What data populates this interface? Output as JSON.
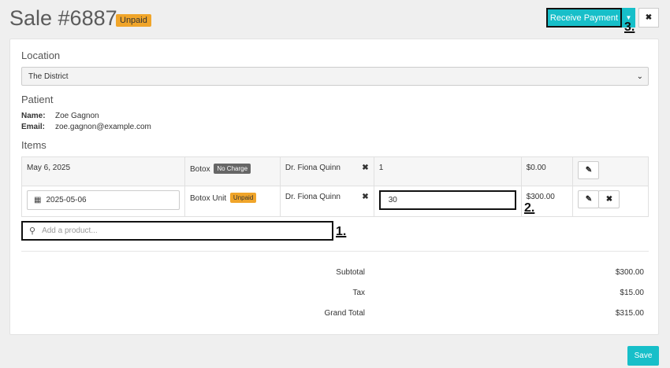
{
  "header": {
    "title": "Sale #6887",
    "status_badge": "Unpaid",
    "receive_payment_label": "Receive Payment",
    "caret_glyph": "▼",
    "close_glyph": "✖"
  },
  "markers": {
    "m1": "1.",
    "m2": "2.",
    "m3": "3."
  },
  "location": {
    "label": "Location",
    "selected": "The District"
  },
  "patient": {
    "label": "Patient",
    "name_key": "Name:",
    "name_value": "Zoe Gagnon",
    "email_key": "Email:",
    "email_value": "zoe.gagnon@example.com"
  },
  "items": {
    "label": "Items",
    "rows": [
      {
        "date": "May 6, 2025",
        "product": "Botox",
        "product_badge": "No Charge",
        "provider": "Dr. Fiona Quinn",
        "quantity": "1",
        "price": "$0.00"
      },
      {
        "date": "2025-05-06",
        "product": "Botox Unit",
        "product_badge": "Unpaid",
        "provider": "Dr. Fiona Quinn",
        "quantity": "30",
        "price": "$300.00"
      }
    ],
    "add_product_placeholder": "Add a product..."
  },
  "totals": {
    "subtotal_label": "Subtotal",
    "subtotal_value": "$300.00",
    "tax_label": "Tax",
    "tax_value": "$15.00",
    "grand_total_label": "Grand Total",
    "grand_total_value": "$315.00"
  },
  "footer": {
    "save_label": "Save"
  },
  "colors": {
    "accent": "#17bfc9",
    "badge_unpaid": "#f0a52a",
    "badge_no_charge": "#666666"
  },
  "icons": [
    "calendar-icon",
    "pencil-icon",
    "close-icon",
    "search-icon",
    "chevron-down-icon"
  ]
}
